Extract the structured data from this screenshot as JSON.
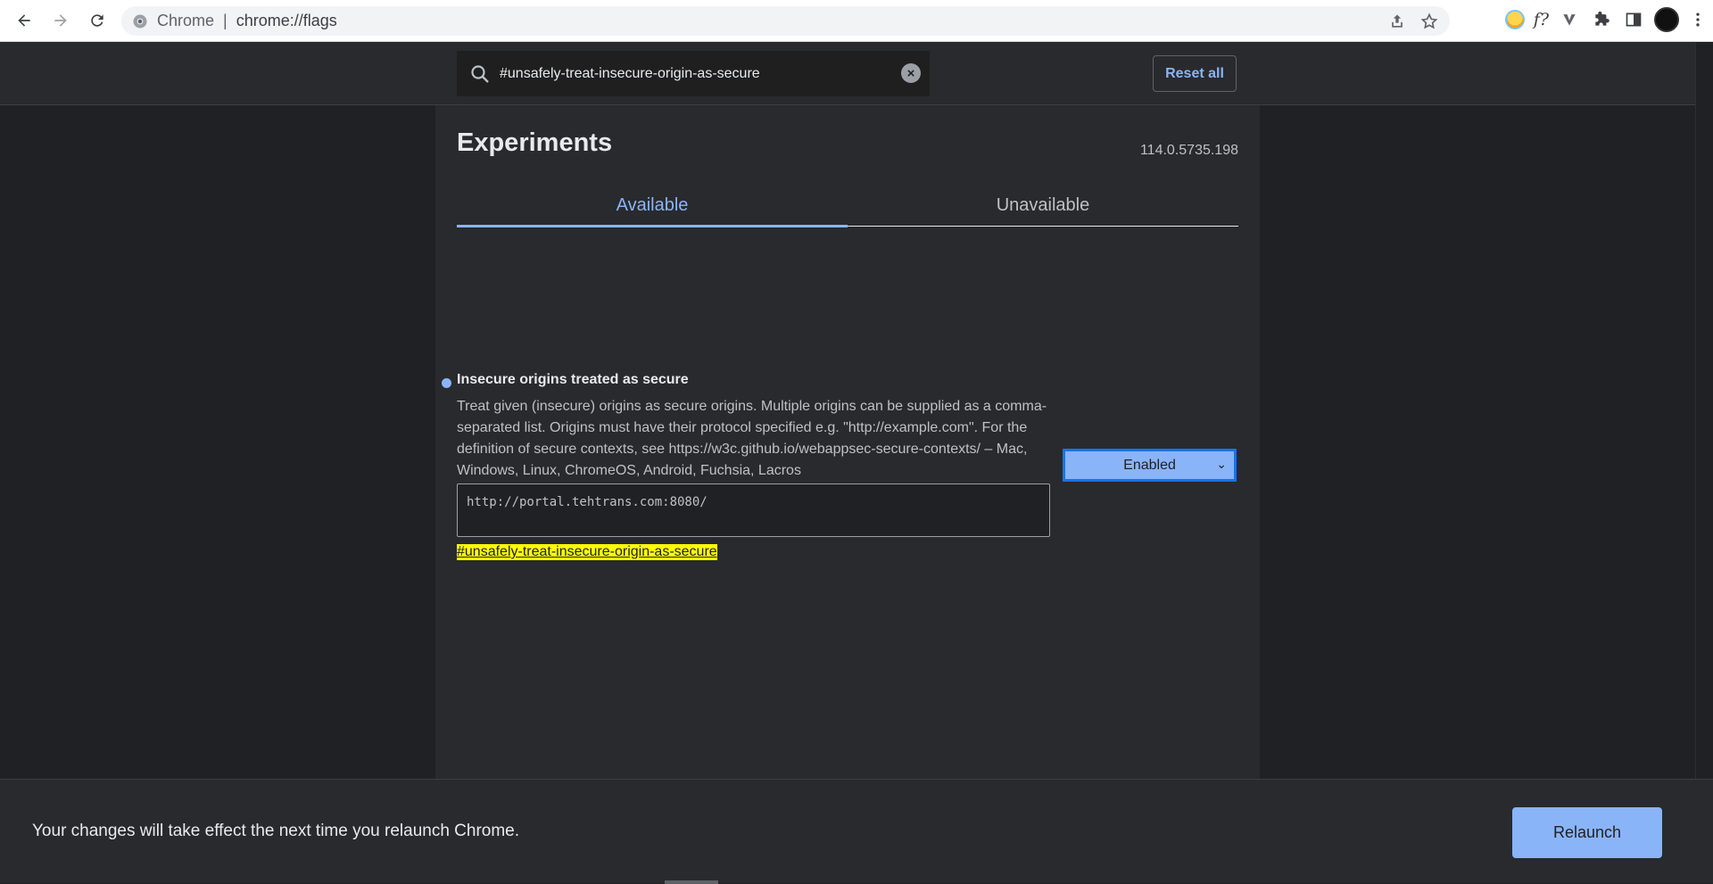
{
  "browser": {
    "scheme_label": "Chrome",
    "url": "chrome://flags",
    "icons": {
      "back": "back-arrow-icon",
      "forward": "forward-arrow-icon",
      "reload": "reload-icon",
      "site_info": "chrome-logo-icon",
      "share": "share-icon",
      "bookmark": "star-icon",
      "extension_emoji": "emoji-extension-icon",
      "extension_fx": "fx-extension-icon",
      "extension_v": "v-extension-icon",
      "extensions": "puzzle-icon",
      "side_panel": "side-panel-icon",
      "profile": "avatar",
      "menu": "kebab-menu-icon"
    },
    "fx_label": "f?"
  },
  "header": {
    "search_value": "#unsafely-treat-insecure-origin-as-secure",
    "reset_label": "Reset all"
  },
  "page": {
    "title": "Experiments",
    "version": "114.0.5735.198",
    "tabs": [
      {
        "label": "Available",
        "active": true
      },
      {
        "label": "Unavailable",
        "active": false
      }
    ]
  },
  "flag": {
    "title": "Insecure origins treated as secure",
    "description": "Treat given (insecure) origins as secure origins. Multiple origins can be supplied as a comma-separated list. Origins must have their protocol specified e.g. \"http://example.com\". For the definition of secure contexts, see https://w3c.github.io/webappsec-secure-contexts/ – Mac, Windows, Linux, ChromeOS, Android, Fuchsia, Lacros",
    "origins_value": "http://portal.tehtrans.com:8080/",
    "anchor": "#unsafely-treat-insecure-origin-as-secure",
    "state": "Enabled"
  },
  "relaunch": {
    "message": "Your changes will take effect the next time you relaunch Chrome.",
    "button_label": "Relaunch"
  },
  "colors": {
    "accent": "#8ab4f8",
    "background": "#202124",
    "surface": "#292a2d",
    "highlight": "#ffff00"
  }
}
